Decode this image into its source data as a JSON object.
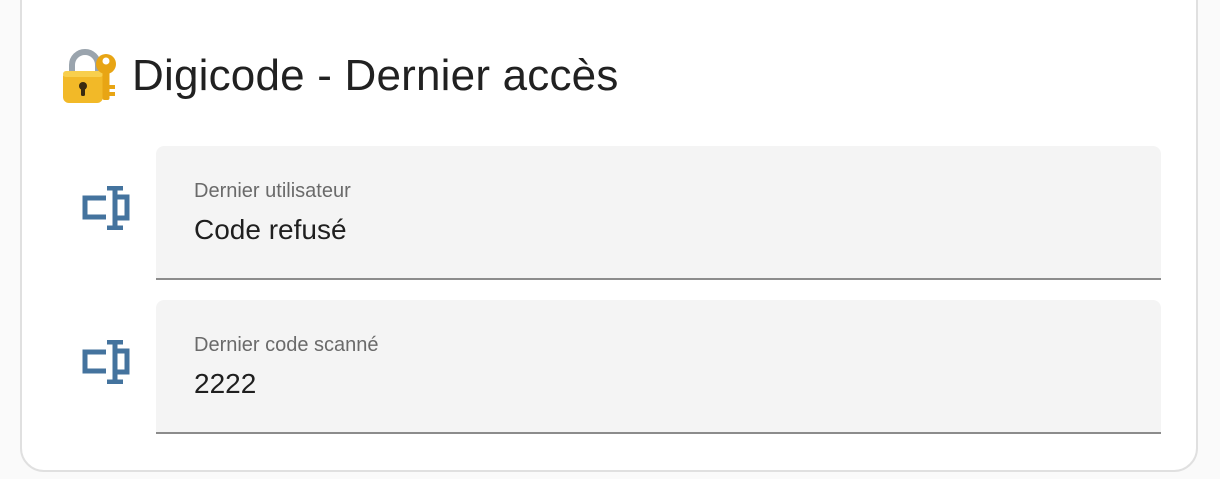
{
  "card": {
    "title": "Digicode - Dernier accès",
    "title_icon": "locked-with-key-emoji"
  },
  "rows": [
    {
      "icon": "keypad-icon",
      "label": "Dernier utilisateur",
      "value": "Code refusé"
    },
    {
      "icon": "keypad-icon",
      "label": "Dernier code scanné",
      "value": "2222"
    }
  ],
  "colors": {
    "icon": "#44739e",
    "field_background": "#f4f4f4",
    "field_underline": "#8c8c8c",
    "label": "#6a6a6a",
    "value": "#1f1f1f"
  }
}
